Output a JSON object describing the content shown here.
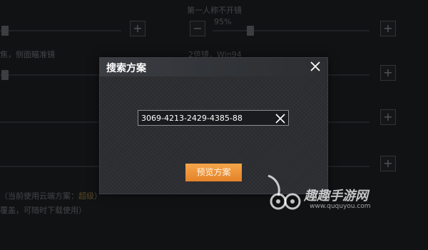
{
  "background": {
    "top_right_label": "第一人称不开镜",
    "top_right_value": "95%",
    "left_label": "焦，侧面瞄准镜",
    "middle_label": "2倍镜，Win94",
    "bottom_line_1": "（当前使用云端方案：",
    "bottom_line_1_highlight": "超级",
    "bottom_line_1_end": "）",
    "bottom_line_2": "覆盖，可随时下载使用）"
  },
  "dialog": {
    "title": "搜索方案",
    "code_value": "3069-4213-2429-4385-88",
    "preview_label": "预览方案"
  },
  "watermark": {
    "brand": "趣趣手游网",
    "url": "www.ququyou.com"
  },
  "icons": {
    "close": "close-icon",
    "clear": "clear-icon",
    "plus": "plus-icon",
    "minus": "minus-icon"
  },
  "colors": {
    "accent": "#f0983c",
    "highlight_text": "#d9a23a"
  }
}
